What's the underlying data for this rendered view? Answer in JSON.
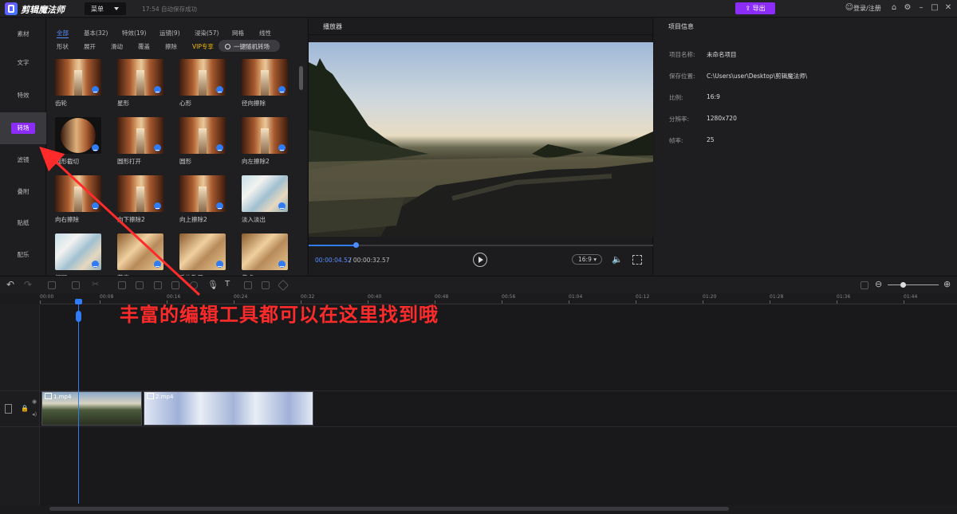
{
  "titlebar": {
    "app_title": "剪辑魔法师",
    "menu_label": "菜单",
    "autosave": "17:54 自动保存成功",
    "export_label": "导出",
    "login_label": "登录/注册"
  },
  "left_nav": [
    "素材",
    "文字",
    "特效",
    "转场",
    "滤镜",
    "叠附",
    "贴纸",
    "配乐"
  ],
  "library": {
    "tabs_row1": [
      "全部",
      "基本(32)",
      "特效(19)",
      "运镜(9)",
      "浸染(57)",
      "网格",
      "线性"
    ],
    "tabs_row2": [
      "形状",
      "展开",
      "滑动",
      "覆盖",
      "擦除",
      "VIP专享"
    ],
    "random_button": "一键随机转场",
    "tiles": [
      {
        "label": "齿轮"
      },
      {
        "label": "星形"
      },
      {
        "label": "心形"
      },
      {
        "label": "径向擦除"
      },
      {
        "label": "圆形截切"
      },
      {
        "label": "圆形打开"
      },
      {
        "label": "圆形"
      },
      {
        "label": "向左擦除2"
      },
      {
        "label": "向右擦除"
      },
      {
        "label": "向下擦除2"
      },
      {
        "label": "向上擦除2"
      },
      {
        "label": "淡入淡出"
      },
      {
        "label": "闪回"
      },
      {
        "label": "萃喜"
      },
      {
        "label": "毛片散开"
      },
      {
        "label": "焦点"
      }
    ]
  },
  "player": {
    "title": "播放器",
    "time_current": "00:00:04.52",
    "time_total": "/ 00:00:32.57",
    "progress": 0.14,
    "ratio": "16:9"
  },
  "info": {
    "title": "项目信息",
    "rows": [
      {
        "label": "项目名称:",
        "value": "未命名项目"
      },
      {
        "label": "保存位置:",
        "value": "C:\\Users\\user\\Desktop\\剪辑魔法师\\"
      },
      {
        "label": "比例:",
        "value": "16:9"
      },
      {
        "label": "分辨率:",
        "value": "1280x720"
      },
      {
        "label": "帧率:",
        "value": "25"
      }
    ]
  },
  "timeline": {
    "ticks": [
      "00:00",
      "00:08",
      "00:16",
      "00:24",
      "00:32",
      "00:40",
      "00:48",
      "00:56",
      "01:04",
      "01:12",
      "01:20",
      "01:28",
      "01:36",
      "01:44"
    ],
    "clips": [
      {
        "name": "1.mp4"
      },
      {
        "name": "2.mp4"
      }
    ]
  },
  "annotation": "丰富的编辑工具都可以在这里找到哦",
  "colors": {
    "accent": "#8b2df7",
    "timeline_blue": "#2f7cf6",
    "annotation_red": "#ff2b2b"
  }
}
